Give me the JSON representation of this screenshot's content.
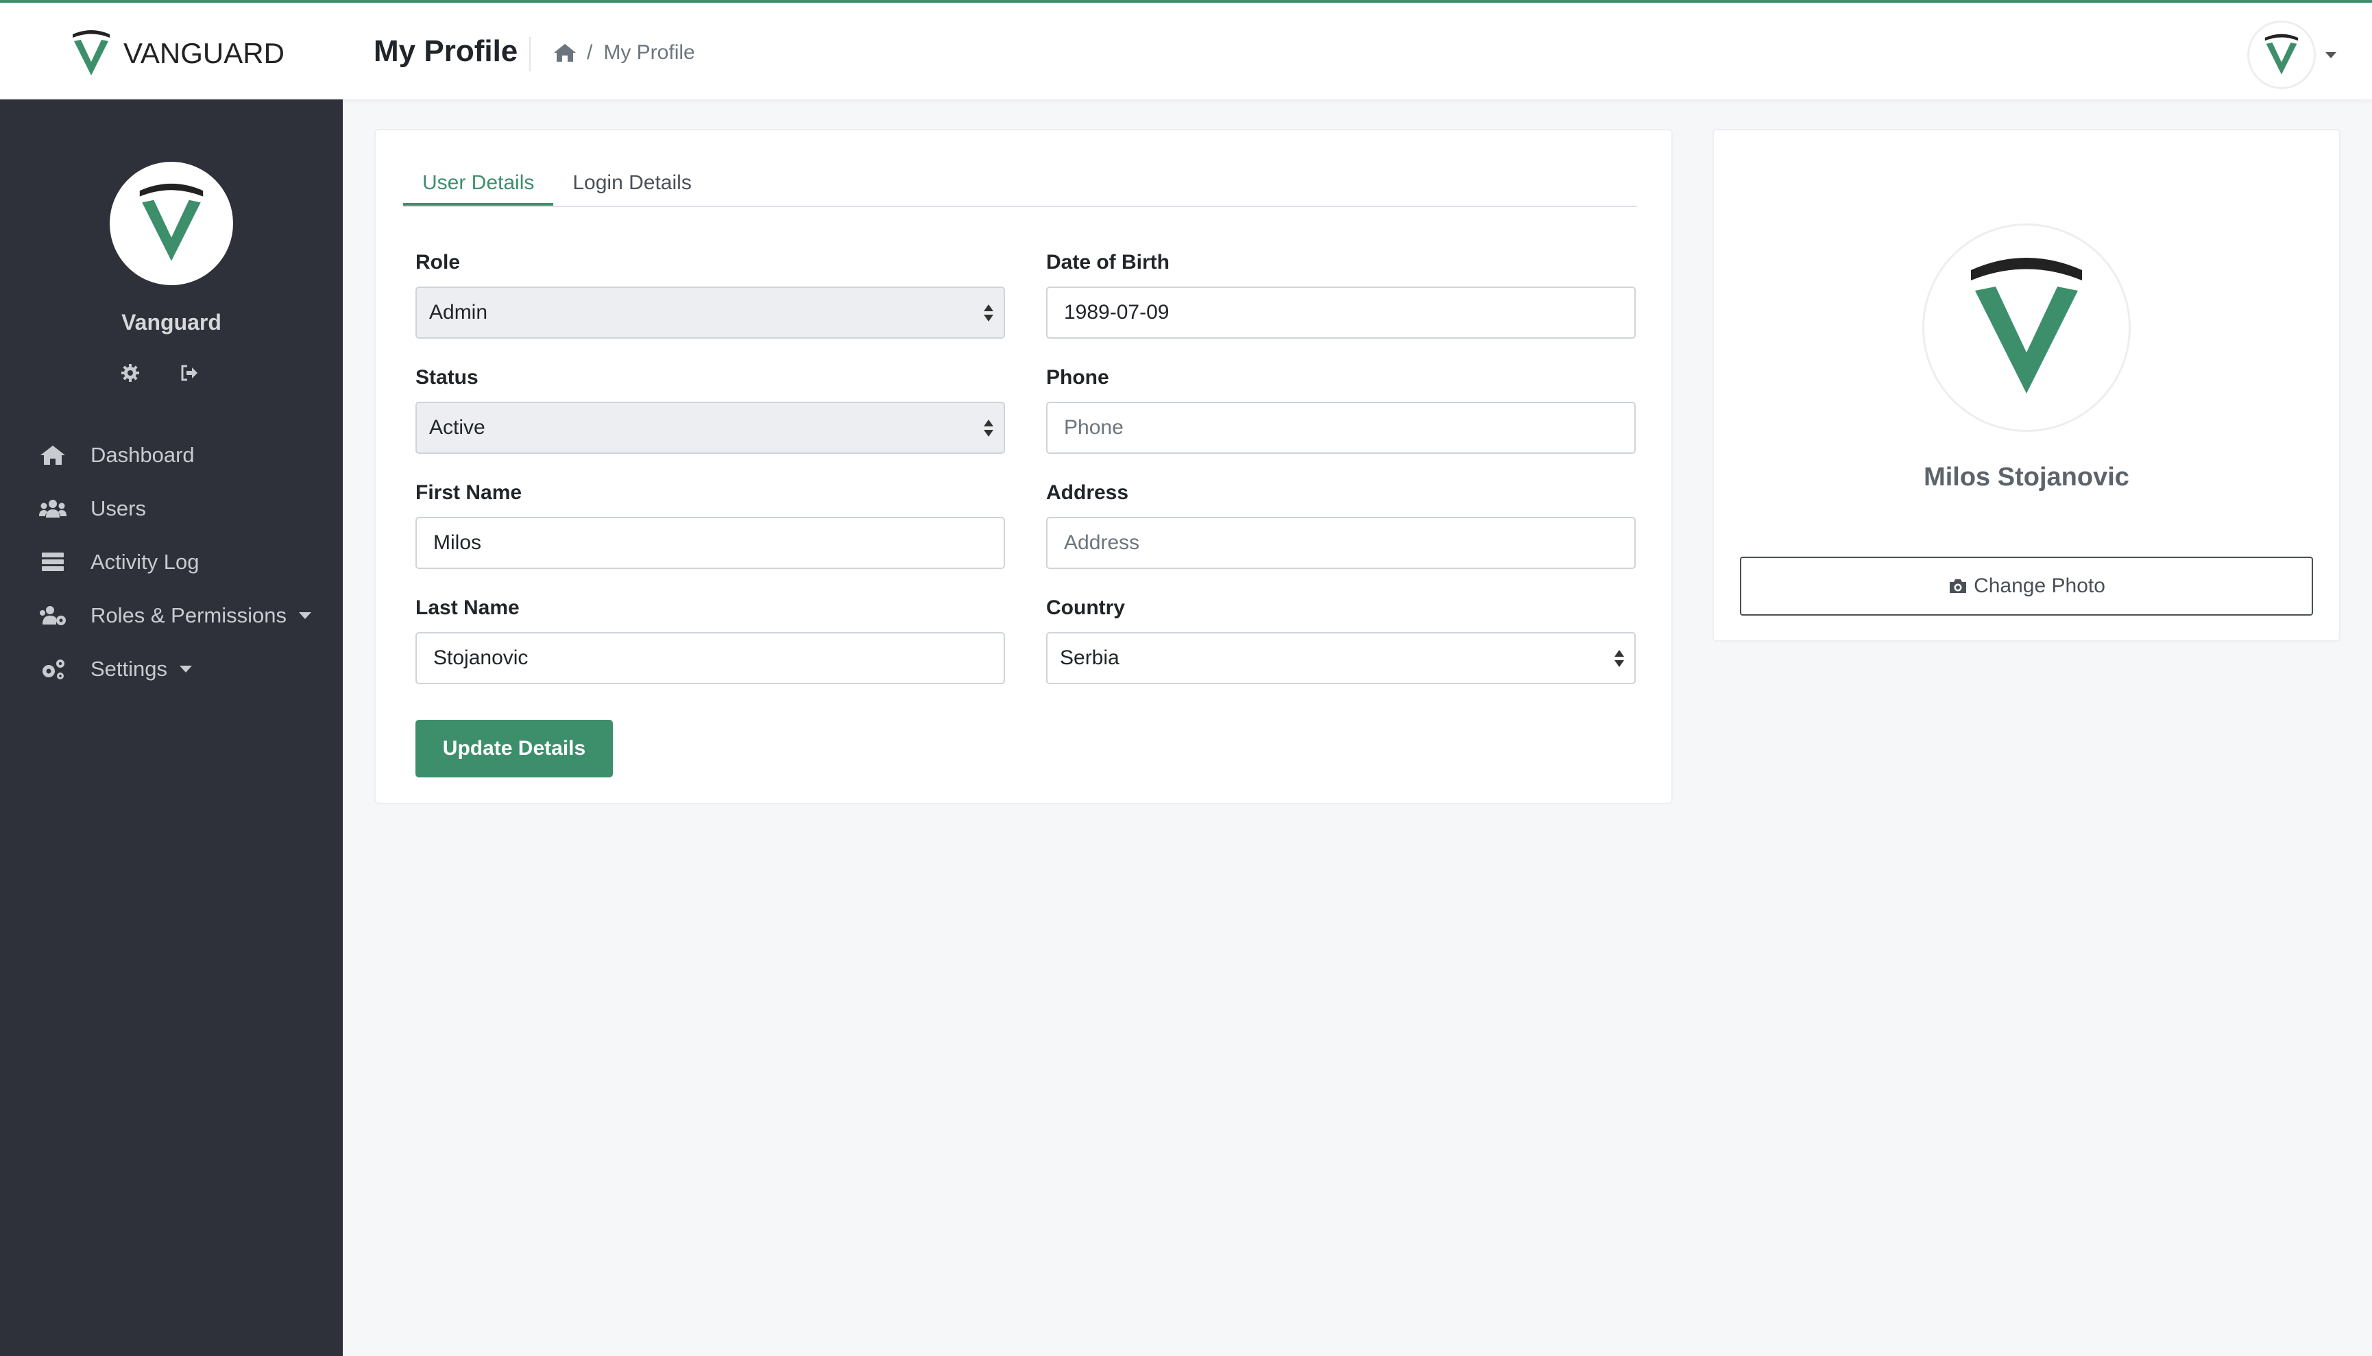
{
  "brand": {
    "name": "VANGUARD",
    "logo_icon": "vanguard-shield-logo"
  },
  "header": {
    "title": "My Profile",
    "breadcrumb": {
      "home_icon": "home-icon",
      "separator": "/",
      "current": "My Profile"
    }
  },
  "sidebar": {
    "user_name": "Vanguard",
    "actions": [
      {
        "icon": "gear-icon"
      },
      {
        "icon": "sign-out-icon"
      }
    ],
    "items": [
      {
        "label": "Dashboard",
        "icon": "home-icon"
      },
      {
        "label": "Users",
        "icon": "users-icon"
      },
      {
        "label": "Activity Log",
        "icon": "server-icon"
      },
      {
        "label": "Roles & Permissions",
        "icon": "users-cog-icon",
        "has_submenu": true
      },
      {
        "label": "Settings",
        "icon": "cogs-icon",
        "has_submenu": true
      }
    ]
  },
  "tabs": [
    {
      "label": "User Details",
      "active": true
    },
    {
      "label": "Login Details",
      "active": false
    }
  ],
  "form": {
    "role": {
      "label": "Role",
      "value": "Admin"
    },
    "status": {
      "label": "Status",
      "value": "Active"
    },
    "first_name": {
      "label": "First Name",
      "value": "Milos"
    },
    "last_name": {
      "label": "Last Name",
      "value": "Stojanovic"
    },
    "dob": {
      "label": "Date of Birth",
      "value": "1989-07-09"
    },
    "phone": {
      "label": "Phone",
      "value": "",
      "placeholder": "Phone"
    },
    "address": {
      "label": "Address",
      "value": "",
      "placeholder": "Address"
    },
    "country": {
      "label": "Country",
      "value": "Serbia"
    },
    "submit_label": "Update Details"
  },
  "profile_card": {
    "name": "Milos Stojanovic",
    "change_photo_label": "Change Photo",
    "change_photo_icon": "camera-icon"
  },
  "colors": {
    "accent": "#3d8f6c",
    "sidebar_bg": "#2e3139",
    "page_bg": "#f6f7f9"
  }
}
